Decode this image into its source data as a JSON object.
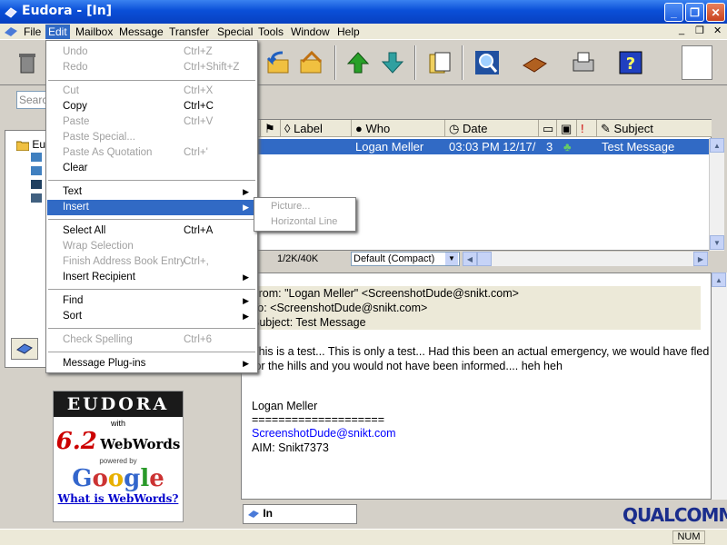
{
  "window": {
    "title": "Eudora - [In]",
    "minimize_glyph": "_",
    "restore_glyph": "❐",
    "close_glyph": "✕"
  },
  "menubar": [
    "File",
    "Edit",
    "Mailbox",
    "Message",
    "Transfer",
    "Special",
    "Tools",
    "Window",
    "Help"
  ],
  "search": {
    "placeholder": "Search"
  },
  "columns": {
    "label": "Label",
    "who": "Who",
    "date": "Date",
    "subject": "Subject"
  },
  "message": {
    "who": "Logan Meller",
    "date": "03:03 PM 12/17/",
    "priority": "3",
    "subject": "Test Message"
  },
  "list_status": {
    "size": "1/2K/40K",
    "view": "Default (Compact)"
  },
  "preview": {
    "from": "From: \"Logan Meller\" <ScreenshotDude@snikt.com>",
    "to": "To: <ScreenshotDude@snikt.com>",
    "subject": "Subject: Test Message",
    "body1": "This is a test... This is only a test... Had this been an actual emergency, we would have fled",
    "body2": "for the hills and you would not have been informed.... heh heh",
    "sig_name": "Logan Meller",
    "sig_rule": "====================",
    "sig_email": "ScreenshotDude@snikt.com",
    "sig_aim": "AIM: Snikt7373"
  },
  "mailbox_tab": "In",
  "ad": {
    "brand": "EUDORA",
    "version": "6.2",
    "with": "with",
    "webwords": "WebWords",
    "powered": "powered by",
    "google": "Google",
    "link": "What is WebWords?"
  },
  "vendor": "QUALCOMM",
  "statusbar": {
    "num": "NUM"
  },
  "edit_menu": {
    "undo": {
      "label": "Undo",
      "acc": "Ctrl+Z"
    },
    "redo": {
      "label": "Redo",
      "acc": "Ctrl+Shift+Z"
    },
    "cut": {
      "label": "Cut",
      "acc": "Ctrl+X"
    },
    "copy": {
      "label": "Copy",
      "acc": "Ctrl+C"
    },
    "paste": {
      "label": "Paste",
      "acc": "Ctrl+V"
    },
    "paste_special": {
      "label": "Paste Special..."
    },
    "paste_quotation": {
      "label": "Paste As Quotation",
      "acc": "Ctrl+'"
    },
    "clear": {
      "label": "Clear"
    },
    "text": {
      "label": "Text"
    },
    "insert": {
      "label": "Insert"
    },
    "select_all": {
      "label": "Select All",
      "acc": "Ctrl+A"
    },
    "wrap": {
      "label": "Wrap Selection"
    },
    "finish_addr": {
      "label": "Finish Address Book Entry",
      "acc": "Ctrl+,"
    },
    "insert_recipient": {
      "label": "Insert Recipient"
    },
    "find": {
      "label": "Find"
    },
    "sort": {
      "label": "Sort"
    },
    "spelling": {
      "label": "Check Spelling",
      "acc": "Ctrl+6"
    },
    "plugins": {
      "label": "Message Plug-ins"
    }
  },
  "insert_submenu": {
    "picture": "Picture...",
    "hline": "Horizontal Line"
  },
  "colors": {
    "titlebar": "#0a4fd8",
    "highlight": "#316ac5",
    "link": "#0000ff"
  }
}
